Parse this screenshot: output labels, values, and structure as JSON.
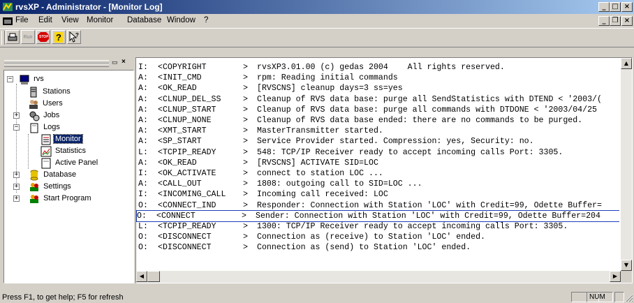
{
  "window": {
    "title": "rvsXP - Administrator - [Monitor Log]"
  },
  "menu": [
    "File",
    "Edit",
    "View",
    "Monitor",
    "Database",
    "Window",
    "?"
  ],
  "toolbar": {
    "run_label": "Run",
    "stop_label": "STOP"
  },
  "tree": {
    "root": "rvs",
    "items": [
      {
        "label": "Stations",
        "icon": "station-icon"
      },
      {
        "label": "Users",
        "icon": "users-icon"
      },
      {
        "label": "Jobs",
        "icon": "jobs-icon"
      },
      {
        "label": "Logs",
        "icon": "folder-icon"
      },
      {
        "label": "Monitor",
        "icon": "monitor-log-icon",
        "selected": true
      },
      {
        "label": "Statistics",
        "icon": "statistics-icon"
      },
      {
        "label": "Active Panel",
        "icon": "panel-icon"
      },
      {
        "label": "Database",
        "icon": "database-icon"
      },
      {
        "label": "Settings",
        "icon": "settings-icon"
      },
      {
        "label": "Start Program",
        "icon": "start-program-icon"
      }
    ]
  },
  "log": {
    "lines": [
      {
        "type": "I:",
        "code": "<COPYRIGHT",
        "sep": ">",
        "msg": "rvsXP3.01.00 (c) gedas 2004    All rights reserved."
      },
      {
        "type": "A:",
        "code": "<INIT_CMD",
        "sep": ">",
        "msg": "rpm: Reading initial commands"
      },
      {
        "type": "A:",
        "code": "<OK_READ",
        "sep": ">",
        "msg": "[RVSCNS] cleanup days=3 ss=yes"
      },
      {
        "type": "A:",
        "code": "<CLNUP_DEL_SS",
        "sep": ">",
        "msg": "Cleanup of RVS data base: purge all SendStatistics with DTEND < '2003/("
      },
      {
        "type": "A:",
        "code": "<CLNUP_START",
        "sep": ">",
        "msg": "Cleanup of RVS data base: purge all commands with DTDONE < '2003/04/25"
      },
      {
        "type": "A:",
        "code": "<CLNUP_NONE",
        "sep": ">",
        "msg": "Cleanup of RVS data base ended: there are no commands to be purged."
      },
      {
        "type": "A:",
        "code": "<XMT_START",
        "sep": ">",
        "msg": "MasterTransmitter started."
      },
      {
        "type": "A:",
        "code": "<SP_START",
        "sep": ">",
        "msg": "Service Provider started. Compression: yes, Security: no."
      },
      {
        "type": "L:",
        "code": "<TCPIP_READY",
        "sep": ">",
        "msg": "548: TCP/IP Receiver ready to accept incoming calls Port: 3305."
      },
      {
        "type": "A:",
        "code": "<OK_READ",
        "sep": ">",
        "msg": "[RVSCNS] ACTIVATE SID=LOC"
      },
      {
        "type": "I:",
        "code": "<OK_ACTIVATE",
        "sep": ">",
        "msg": "connect to station LOC ..."
      },
      {
        "type": "A:",
        "code": "<CALL_OUT",
        "sep": ">",
        "msg": "1808: outgoing call to SID=LOC ..."
      },
      {
        "type": "I:",
        "code": "<INCOMING_CALL",
        "sep": ">",
        "msg": "Incoming call received: LOC"
      },
      {
        "type": "O:",
        "code": "<CONNECT_IND",
        "sep": ">",
        "msg": "Responder: Connection with Station 'LOC' with Credit=99, Odette Buffer="
      },
      {
        "type": "O:",
        "code": "<CONNECT",
        "sep": ">",
        "msg": "Sender: Connection with Station 'LOC' with Credit=99, Odette Buffer=204",
        "selected": true
      },
      {
        "type": "L:",
        "code": "<TCPIP_READY",
        "sep": ">",
        "msg": "1300: TCP/IP Receiver ready to accept incoming calls Port: 3305."
      },
      {
        "type": "O:",
        "code": "<DISCONNECT",
        "sep": ">",
        "msg": "Connection as (receive) to Station 'LOC' ended."
      },
      {
        "type": "O:",
        "code": "<DISCONNECT",
        "sep": ">",
        "msg": "Connection as (send) to Station 'LOC' ended."
      }
    ]
  },
  "status": {
    "help": "Press F1, to get help; F5 for refresh",
    "num": "NUM"
  },
  "colors": {
    "title_start": "#0a246a",
    "title_end": "#a6caf0",
    "face": "#d4d0c8",
    "selection_border": "#1c3fb8"
  }
}
